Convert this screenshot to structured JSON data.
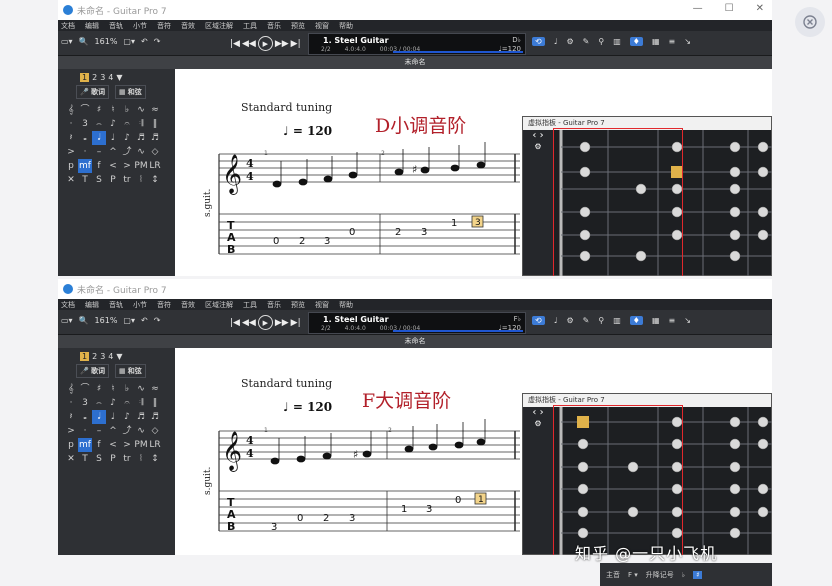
{
  "colors": {
    "accent": "#3c7bd6",
    "heading_red": "#b2202a",
    "note_highlight": "#e0b24a",
    "dark_panel": "#2e3034",
    "red_box": "#e0282c"
  },
  "overlay": {
    "close_icon": "close-icon"
  },
  "menu": [
    "文档",
    "编辑",
    "音轨",
    "小节",
    "音符",
    "音效",
    "区域注解",
    "工具",
    "音乐",
    "预览",
    "视窗",
    "帮助"
  ],
  "windows": [
    {
      "id": "top",
      "app_title": "未命名 - Guitar Pro 7",
      "zoom": "161%",
      "track": "1. Steel Guitar",
      "position": "2/2",
      "signature": "4.0:4.0",
      "time": "00:03 / 00:04",
      "key": "D♭",
      "tempo": "♩=120",
      "doc_title": "未命名",
      "tabs": [
        "1",
        "2",
        "3",
        "4"
      ],
      "lyrics_btn": "歌词",
      "chord_btn": "和弦",
      "standard_tuning": "Standard tuning",
      "tempo_text": "♩ = 120",
      "heading": "D小调音阶",
      "instrument": "s.guit.",
      "tab_clef": [
        "T",
        "A",
        "B"
      ],
      "bar_numbers": [
        "1",
        "2"
      ],
      "tab_frets_m1": [
        "0",
        "2",
        "3",
        "0"
      ],
      "tab_frets_m2": [
        "2",
        "3",
        "1",
        "3"
      ],
      "fretboard_title": "虚拟指板 - Guitar Pro 7"
    },
    {
      "id": "bottom",
      "app_title": "未命名 - Guitar Pro 7",
      "zoom": "161%",
      "track": "1. Steel Guitar",
      "position": "2/2",
      "signature": "4.0:4.0",
      "time": "00:03 / 00:04",
      "key": "F♭",
      "tempo": "♩=120",
      "doc_title": "未命名",
      "tabs": [
        "1",
        "2",
        "3",
        "4"
      ],
      "lyrics_btn": "歌词",
      "chord_btn": "和弦",
      "standard_tuning": "Standard tuning",
      "tempo_text": "♩ = 120",
      "heading": "F大调音阶",
      "instrument": "s.guit.",
      "tab_clef": [
        "T",
        "A",
        "B"
      ],
      "bar_numbers": [
        "1",
        "2"
      ],
      "tab_frets_m1": [
        "3",
        "0",
        "2",
        "3"
      ],
      "tab_frets_m2": [
        "1",
        "3",
        "0",
        "1"
      ],
      "fretboard_title": "虚拟指板 - Guitar Pro 7"
    }
  ],
  "watermark": "知乎 @一只小飞机",
  "bottom_toolbar": {
    "tuning_label": "主音",
    "key_label": "升降记号"
  }
}
